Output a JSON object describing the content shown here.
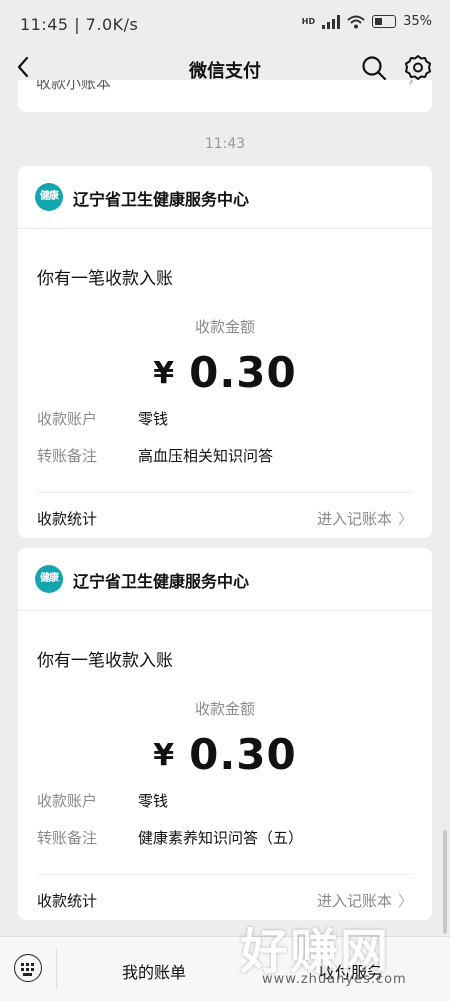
{
  "status_bar": {
    "time": "11:45 | 7.0K/s",
    "network_badge": "HD",
    "battery": "35%"
  },
  "nav": {
    "back_icon": "chevron-left-icon",
    "title": "微信支付",
    "search_icon": "search-icon",
    "settings_icon": "gear-icon"
  },
  "partial_card": {
    "text": "收款小账本",
    "chevron": "›"
  },
  "timestamp": "11:43",
  "cards": [
    {
      "logo_text": "健康",
      "merchant": "辽宁省卫生健康服务中心",
      "headline": "你有一笔收款入账",
      "amount_label": "收款金额",
      "currency": "¥",
      "amount": "0.30",
      "rows": [
        {
          "key": "收款账户",
          "value": "零钱"
        },
        {
          "key": "转账备注",
          "value": "高血压相关知识问答"
        }
      ],
      "footer_left": "收款统计",
      "footer_right": "进入记账本",
      "footer_chevron": "〉"
    },
    {
      "logo_text": "健康",
      "merchant": "辽宁省卫生健康服务中心",
      "headline": "你有一笔收款入账",
      "amount_label": "收款金额",
      "currency": "¥",
      "amount": "0.30",
      "rows": [
        {
          "key": "收款账户",
          "value": "零钱"
        },
        {
          "key": "转账备注",
          "value": "健康素养知识问答（五）"
        }
      ],
      "footer_left": "收款统计",
      "footer_right": "进入记账本",
      "footer_chevron": "〉"
    }
  ],
  "bottom_bar": {
    "keyboard_icon": "keyboard-icon",
    "tab1": "我的账单",
    "tab2": "收付服务"
  },
  "watermark": {
    "big": "好赚网",
    "small": "www.zhuanyes.com"
  },
  "colors": {
    "background": "#ededed",
    "card": "#ffffff",
    "logo_teal": "#13a6b0",
    "muted_text": "#8a8a8a"
  }
}
